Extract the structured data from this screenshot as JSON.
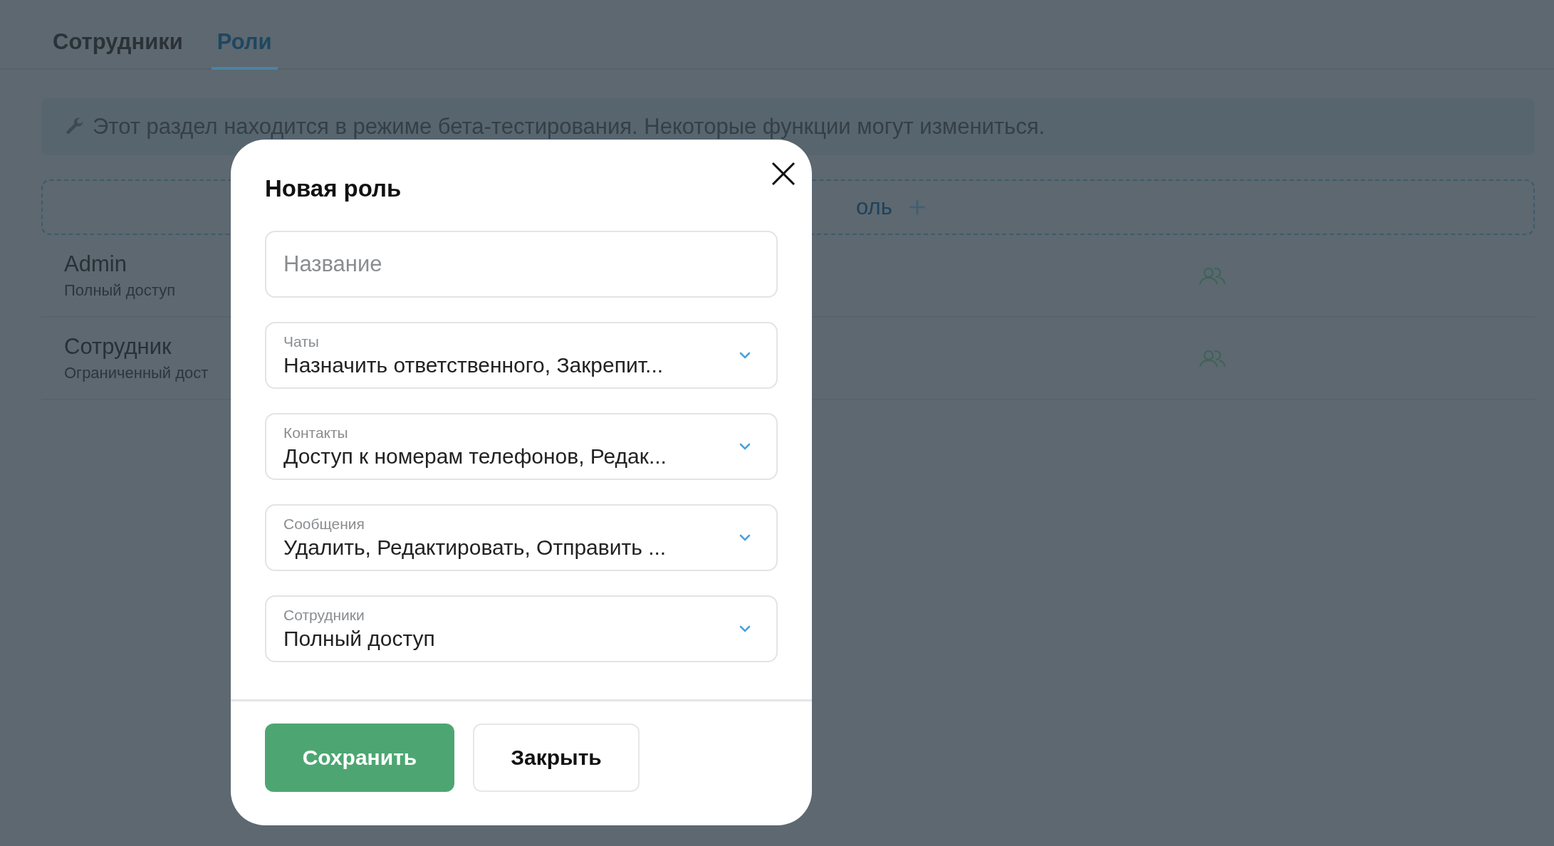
{
  "tabs": [
    {
      "label": "Сотрудники",
      "selected": false
    },
    {
      "label": "Роли",
      "selected": true
    }
  ],
  "beta_banner": {
    "text": "Этот раздел находится в режиме бета-тестирования. Некоторые функции могут измениться."
  },
  "add_role_button": {
    "label": "оль"
  },
  "roles": [
    {
      "name": "Admin",
      "description": "Полный доступ"
    },
    {
      "name": "Сотрудник",
      "description": "Ограниченный дост"
    }
  ],
  "modal": {
    "title": "Новая роль",
    "name_field": {
      "placeholder": "Название"
    },
    "permissions": [
      {
        "label": "Чаты",
        "value": "Назначить ответственного, Закрепит..."
      },
      {
        "label": "Контакты",
        "value": "Доступ к номерам телефонов, Редак..."
      },
      {
        "label": "Сообщения",
        "value": "Удалить, Редактировать, Отправить ..."
      },
      {
        "label": "Сотрудники",
        "value": "Полный доступ"
      }
    ],
    "buttons": [
      {
        "label": "Сохранить",
        "kind": "primary"
      },
      {
        "label": "Закрыть",
        "kind": "secondary"
      }
    ]
  }
}
